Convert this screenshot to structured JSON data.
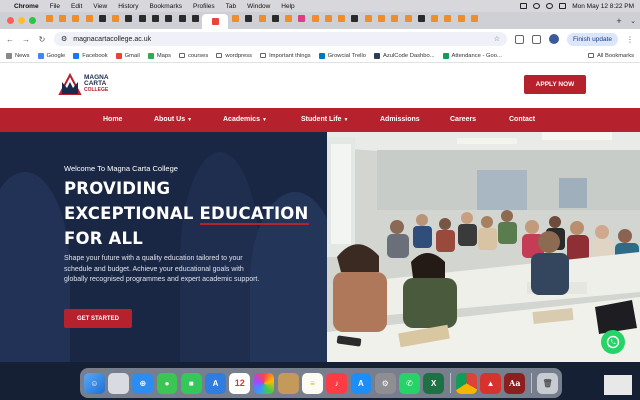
{
  "menubar": {
    "items": [
      "Chrome",
      "File",
      "Edit",
      "View",
      "History",
      "Bookmarks",
      "Profiles",
      "Tab",
      "Window",
      "Help"
    ],
    "datetime": "Mon May 12  8:22 PM"
  },
  "browser": {
    "url": "magnacartacollege.ac.uk",
    "update_label": "Finish update",
    "bookmarks": [
      "News",
      "Google",
      "Facebook",
      "Gmail",
      "Maps",
      "courses",
      "wordpress",
      "Important things",
      "Growcial Trello",
      "AzulCode Dashbo...",
      "Attendance - Goo..."
    ],
    "all_bookmarks": "All Bookmarks"
  },
  "site": {
    "logo_line1": "MAGNA",
    "logo_line2": "CARTA",
    "logo_line3": "COLLEGE",
    "apply_label": "APPLY NOW",
    "nav": [
      "Home",
      "About Us",
      "Academics",
      "Student Life",
      "Admissions",
      "Careers",
      "Contact"
    ],
    "hero": {
      "welcome": "Welcome To Magna Carta College",
      "headline_1": "PROVIDING",
      "headline_2a": "EXCEPTIONAL ",
      "headline_2b": "EDUCATION",
      "headline_3": "FOR ALL",
      "description": "Shape your future with a quality education tailored to your schedule and budget. Achieve your educational goals with globally recognised programmes and expert academic support.",
      "cta": "GET STARTED"
    }
  },
  "dock": {
    "calendar_day": "12"
  },
  "colors": {
    "brand_red": "#b5212c",
    "hero_navy": "#1a2744",
    "whatsapp": "#25d366"
  }
}
